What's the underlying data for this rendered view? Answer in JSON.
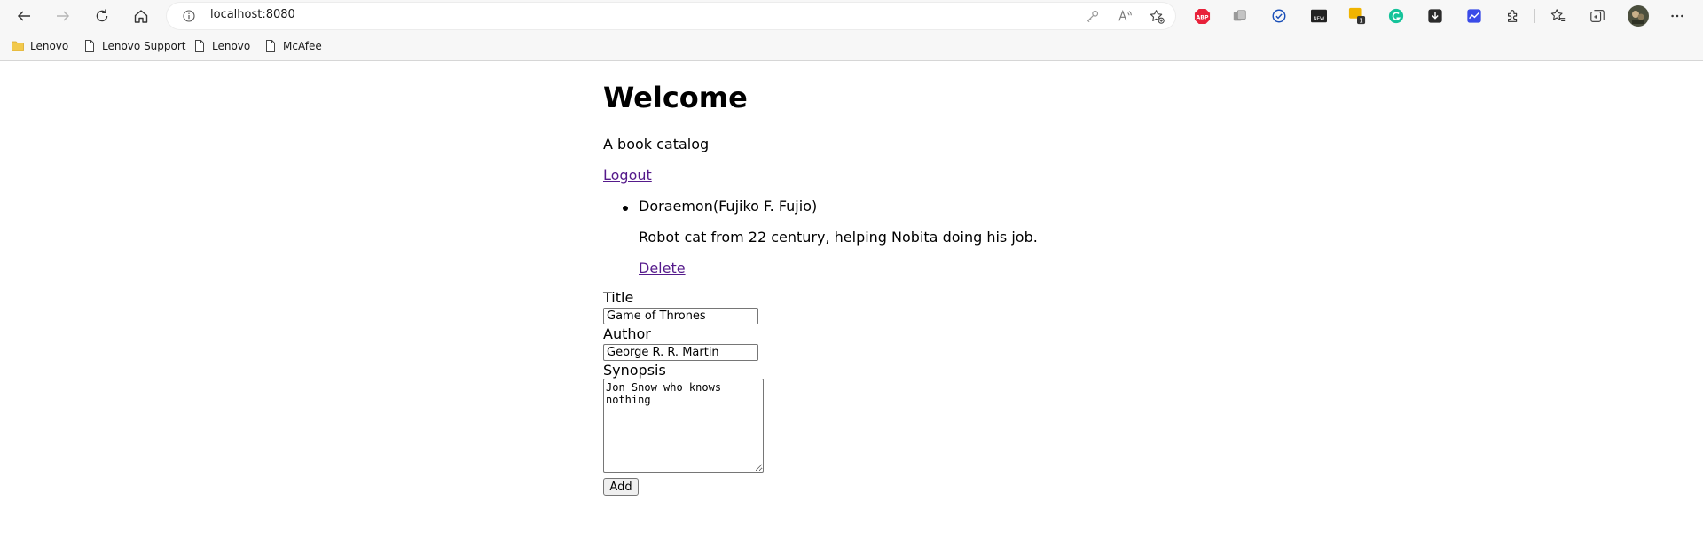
{
  "browser": {
    "url": "localhost:8080",
    "bookmarks": [
      "Lenovo",
      "Lenovo Support",
      "Lenovo",
      "McAfee"
    ],
    "extensions": [
      "adblock-plus",
      "ext-gray",
      "ext-check",
      "ext-new",
      "ext-yellow",
      "grammarly",
      "ext-download",
      "ext-blue",
      "extensions-puzzle"
    ],
    "ext_badge_new": "NEW",
    "ext_badge_count": "1",
    "abp_label": "ABP"
  },
  "page": {
    "heading": "Welcome",
    "subtitle": "A book catalog",
    "logout_label": "Logout",
    "books": [
      {
        "title_author": "Doraemon(Fujiko F. Fujio)",
        "synopsis": "Robot cat from 22 century, helping Nobita doing his job.",
        "delete_label": "Delete"
      }
    ],
    "form": {
      "title_label": "Title",
      "title_value": "Game of Thrones",
      "author_label": "Author",
      "author_value": "George R. R. Martin",
      "synopsis_label": "Synopsis",
      "synopsis_value": "Jon Snow who knows nothing",
      "add_label": "Add"
    }
  },
  "colors": {
    "visited_link": "#551a8b",
    "toolbar_bg": "#f7f7f7"
  }
}
